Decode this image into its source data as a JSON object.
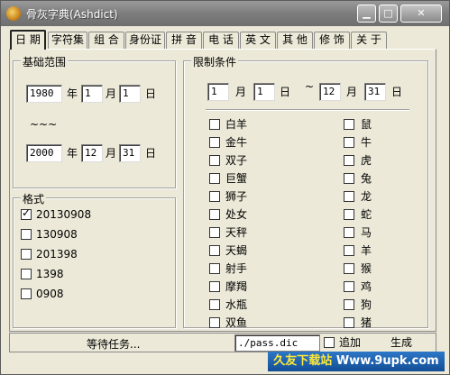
{
  "window": {
    "title": "骨灰字典(Ashdict)"
  },
  "tabs": [
    {
      "label": "日 期"
    },
    {
      "label": "字符集"
    },
    {
      "label": "组 合"
    },
    {
      "label": "身份证"
    },
    {
      "label": "拼 音"
    },
    {
      "label": "电 话"
    },
    {
      "label": "英 文"
    },
    {
      "label": "其 他"
    },
    {
      "label": "修 饰"
    },
    {
      "label": "关 于"
    }
  ],
  "basic_range": {
    "title": "基础范围",
    "start": {
      "year": "1980",
      "year_unit": "年",
      "month": "1",
      "month_unit": "月",
      "day": "1",
      "day_unit": "日"
    },
    "tilde": "~~~",
    "end": {
      "year": "2000",
      "year_unit": "年",
      "month": "12",
      "month_unit": "月",
      "day": "31",
      "day_unit": "日"
    }
  },
  "format": {
    "title": "格式",
    "options": [
      {
        "label": "20130908",
        "checked": true
      },
      {
        "label": "130908",
        "checked": false
      },
      {
        "label": "201398",
        "checked": false
      },
      {
        "label": "1398",
        "checked": false
      },
      {
        "label": "0908",
        "checked": false
      }
    ]
  },
  "limits": {
    "title": "限制条件",
    "from_month": "1",
    "month_unit": "月",
    "from_day": "1",
    "day_unit": "日",
    "tilde": "~",
    "to_month": "12",
    "to_day": "31",
    "zodiac_signs": [
      "白羊",
      "金牛",
      "双子",
      "巨蟹",
      "狮子",
      "处女",
      "天秤",
      "天蝎",
      "射手",
      "摩羯",
      "水瓶",
      "双鱼"
    ],
    "chinese_zodiac": [
      "鼠",
      "牛",
      "虎",
      "兔",
      "龙",
      "蛇",
      "马",
      "羊",
      "猴",
      "鸡",
      "狗",
      "猪"
    ]
  },
  "bottom": {
    "status": "等待任务...",
    "output_file": "./pass.dic",
    "append_label": "追加",
    "generate_label": "生成"
  },
  "watermark": {
    "site_name": "久友下载站",
    "url": "Www.9upk.com"
  }
}
